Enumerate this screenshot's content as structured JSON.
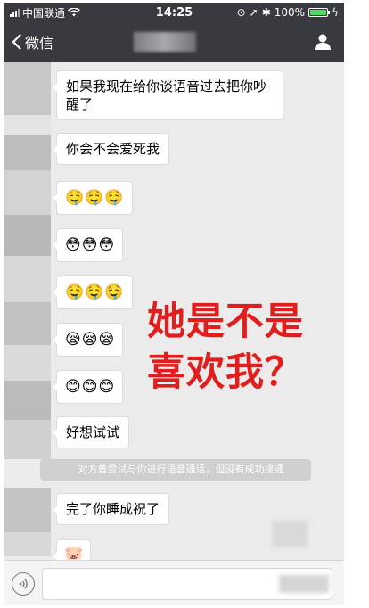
{
  "status_bar": {
    "carrier": "中国联通",
    "time": "14:25",
    "battery": "100%"
  },
  "nav": {
    "back_label": "微信"
  },
  "messages": [
    {
      "text": "如果我现在给你谈语音过去把你吵醒了"
    },
    {
      "text": "你会不会爱死我"
    },
    {
      "emoji": [
        "🤤",
        "🤤",
        "🤤"
      ]
    },
    {
      "emoji": [
        "😳",
        "😳",
        "😳"
      ]
    },
    {
      "emoji": [
        "🤤",
        "🤤",
        "🤤"
      ]
    },
    {
      "emoji": [
        "😪",
        "😪",
        "😪"
      ]
    },
    {
      "emoji": [
        "😊",
        "😊",
        "😊"
      ]
    },
    {
      "text": "好想试试"
    },
    {
      "text": "完了你睡成祝了"
    },
    {
      "emoji": [
        "🐷"
      ]
    }
  ],
  "system_notice": "对方曾尝试与你进行语音通话，但没有成功接通",
  "overlay": {
    "line1": "她是不是",
    "line2": "喜欢我？",
    "color": "#e11d1d"
  },
  "colors": {
    "header": "#393a3f",
    "chat_bg": "#ebebeb",
    "battery": "#4cd964"
  }
}
